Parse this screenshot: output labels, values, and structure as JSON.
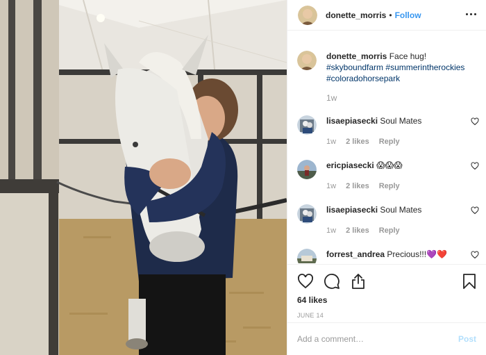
{
  "header": {
    "username": "donette_morris",
    "dot": "•",
    "follow_label": "Follow"
  },
  "caption": {
    "username": "donette_morris",
    "text": "Face hug!",
    "hashtags": [
      "#skyboundfarm",
      "#summerintherockies",
      "#coloradohorsepark"
    ],
    "time": "1w"
  },
  "comments": [
    {
      "username": "lisaepiasecki",
      "text": "Soul Mates",
      "time": "1w",
      "likes": "2 likes",
      "reply": "Reply"
    },
    {
      "username": "ericpiasecki",
      "text": "😱😱😱",
      "time": "1w",
      "likes": "2 likes",
      "reply": "Reply"
    },
    {
      "username": "lisaepiasecki",
      "text": "Soul Mates",
      "time": "1w",
      "likes": "2 likes",
      "reply": "Reply"
    },
    {
      "username": "forrest_andrea",
      "text": "Precious!!!💜❤️"
    }
  ],
  "stats": {
    "likes": "64 likes",
    "date": "JUNE 14"
  },
  "add_comment": {
    "placeholder": "Add a comment…",
    "post_label": "Post"
  },
  "colors": {
    "link": "#3897f0",
    "hashtag": "#003569",
    "muted": "#999999",
    "post_disabled": "#b2dffc"
  },
  "icons": [
    "more-options-icon",
    "heart-icon",
    "comment-icon",
    "share-icon",
    "bookmark-icon"
  ]
}
